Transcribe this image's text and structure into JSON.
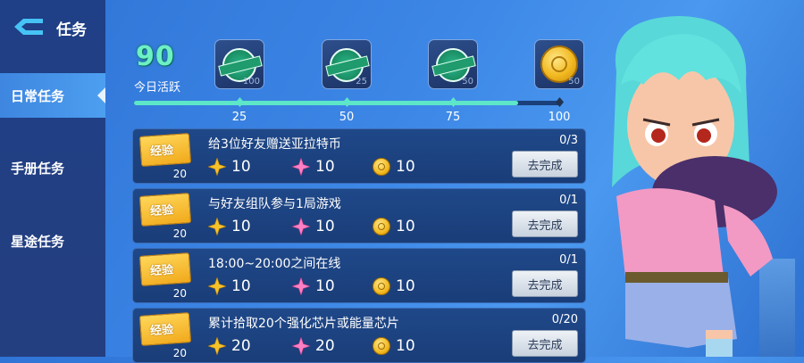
{
  "header": {
    "title": "任务"
  },
  "sidebar": {
    "items": [
      {
        "label": "日常任务",
        "active": true
      },
      {
        "label": "手册任务",
        "active": false
      },
      {
        "label": "星途任务",
        "active": false
      }
    ]
  },
  "activity": {
    "score": "90",
    "label": "今日活跃",
    "milestones": [
      {
        "value": "25",
        "reward_count": "100",
        "reward": "stamp-icon",
        "claimed": true
      },
      {
        "value": "50",
        "reward_count": "25",
        "reward": "stamp-icon",
        "claimed": true
      },
      {
        "value": "75",
        "reward_count": "50",
        "reward": "stamp-icon",
        "claimed": true
      },
      {
        "value": "100",
        "reward_count": "50",
        "reward": "gold-coin-icon",
        "claimed": false
      }
    ],
    "progress_fraction": 0.9
  },
  "tasks": [
    {
      "title": "给3位好友赠送亚拉特币",
      "progress": "0/3",
      "exp_label": "经验",
      "exp_count": "20",
      "rewards": [
        "10",
        "10",
        "10"
      ],
      "button": "去完成"
    },
    {
      "title": "与好友组队参与1局游戏",
      "progress": "0/1",
      "exp_label": "经验",
      "exp_count": "20",
      "rewards": [
        "10",
        "10",
        "10"
      ],
      "button": "去完成"
    },
    {
      "title": "18:00~20:00之间在线",
      "progress": "0/1",
      "exp_label": "经验",
      "exp_count": "20",
      "rewards": [
        "10",
        "10",
        "10"
      ],
      "button": "去完成"
    },
    {
      "title": "累计拾取20个强化芯片或能量芯片",
      "progress": "0/20",
      "exp_label": "经验",
      "exp_count": "20",
      "rewards": [
        "20",
        "20",
        "10"
      ],
      "button": "去完成"
    }
  ],
  "reward_icons": [
    "gold-star-icon",
    "pink-star-icon",
    "gold-coin-icon"
  ],
  "colors": {
    "accent": "#5de6c7",
    "gold": "#f2b920",
    "pink": "#ff7fc4",
    "panel": "#1f4889"
  }
}
